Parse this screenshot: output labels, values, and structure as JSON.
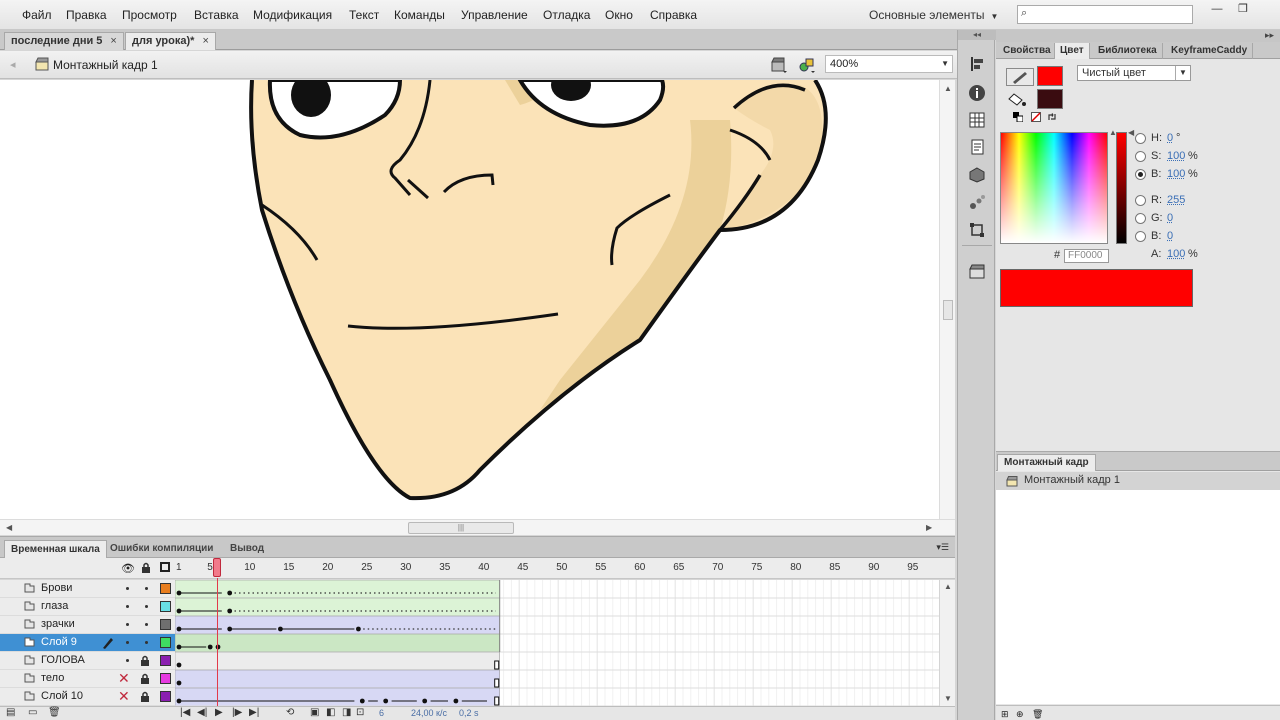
{
  "menu": {
    "items": [
      "Файл",
      "Правка",
      "Просмотр",
      "Вставка",
      "Модификация",
      "Текст",
      "Команды",
      "Управление",
      "Отладка",
      "Окно",
      "Справка"
    ],
    "workspace": "Основные элементы"
  },
  "search": {
    "placeholder": "",
    "icon": "search-icon"
  },
  "window_controls": {
    "minimize": "—",
    "restore": "❐"
  },
  "doc_tabs": [
    {
      "label": "последние дни 5",
      "close": "×"
    },
    {
      "label": "для урока)*",
      "close": "×"
    }
  ],
  "editbar": {
    "scene_label": "Монтажный кадр 1",
    "zoom": "400%"
  },
  "timeline": {
    "tabs": [
      "Временная шкала",
      "Ошибки компиляции",
      "Вывод"
    ],
    "ruler": [
      "1",
      "5",
      "10",
      "15",
      "20",
      "25",
      "30",
      "35",
      "40",
      "45",
      "50",
      "55",
      "60",
      "65",
      "70",
      "75",
      "80",
      "85",
      "90",
      "95"
    ],
    "current_frame": 6,
    "layers": [
      {
        "name": "Брови",
        "color": "#e87d1e",
        "hidden": false,
        "locked": false,
        "selected": false
      },
      {
        "name": "глаза",
        "color": "#69e0e6",
        "hidden": false,
        "locked": false,
        "selected": false
      },
      {
        "name": "зрачки",
        "color": "#6f6f6f",
        "hidden": false,
        "locked": false,
        "selected": false
      },
      {
        "name": "Слой 9",
        "color": "#3fdc62",
        "hidden": false,
        "locked": false,
        "selected": true
      },
      {
        "name": "ГОЛОВА",
        "color": "#8a1fb0",
        "hidden": false,
        "locked": true,
        "selected": false
      },
      {
        "name": "тело",
        "color": "#e63ae0",
        "hidden": true,
        "locked": true,
        "selected": false
      },
      {
        "name": "Слой 10",
        "color": "#8a1fb0",
        "hidden": true,
        "locked": true,
        "selected": false
      }
    ],
    "frame_readout": "6",
    "fps_readout": "24,00 к/с",
    "time_readout": "0,2 s"
  },
  "panel": {
    "tabs": [
      "Свойства",
      "Цвет",
      "Библиотека",
      "KeyframeCaddy"
    ],
    "active_tab": "Цвет",
    "fill_type": "Чистый цвет",
    "stroke_color": "#ff0000",
    "fill_color": "#3a0c10",
    "hsb": [
      {
        "label": "H:",
        "value": "0",
        "unit": "°"
      },
      {
        "label": "S:",
        "value": "100",
        "unit": "%"
      },
      {
        "label": "B:",
        "value": "100",
        "unit": "%"
      }
    ],
    "rgb": [
      {
        "label": "R:",
        "value": "255",
        "unit": ""
      },
      {
        "label": "G:",
        "value": "0",
        "unit": ""
      },
      {
        "label": "B:",
        "value": "0",
        "unit": ""
      }
    ],
    "alpha": {
      "label": "A:",
      "value": "100",
      "unit": "%"
    },
    "hex_hash": "#",
    "hex": "FF0000",
    "preview_color": "#ff0000"
  },
  "scene_panel": {
    "tab": "Монтажный кадр",
    "items": [
      "Монтажный кадр 1"
    ]
  },
  "colors": {
    "skin": "#fbe3b8",
    "skin_shadow": "#ecd19a",
    "outline": "#111111",
    "selected_layer": "#3f90d3",
    "playhead": "#e23a4a"
  }
}
